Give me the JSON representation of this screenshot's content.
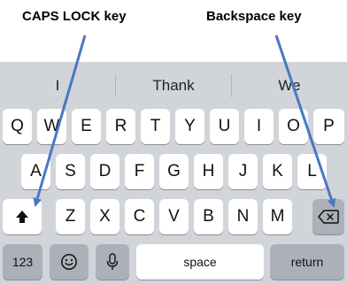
{
  "annotations": {
    "caps_lock_label": "CAPS LOCK key",
    "backspace_label": "Backspace key",
    "arrow_color": "#4a78c2"
  },
  "suggestions": [
    "I",
    "Thank",
    "We"
  ],
  "rows": {
    "row1": [
      "Q",
      "W",
      "E",
      "R",
      "T",
      "Y",
      "U",
      "I",
      "O",
      "P"
    ],
    "row2": [
      "A",
      "S",
      "D",
      "F",
      "G",
      "H",
      "J",
      "K",
      "L"
    ],
    "row3": [
      "Z",
      "X",
      "C",
      "V",
      "B",
      "N",
      "M"
    ]
  },
  "bottom": {
    "numbers_label": "123",
    "emoji_icon": "emoji-icon",
    "mic_icon": "microphone-icon",
    "space_label": "space",
    "return_label": "return"
  },
  "icons": {
    "shift": "shift-icon",
    "backspace": "backspace-icon"
  },
  "colors": {
    "keyboard_bg": "#d1d4d9",
    "key_bg": "#ffffff",
    "dark_key_bg": "#acb1b9"
  }
}
